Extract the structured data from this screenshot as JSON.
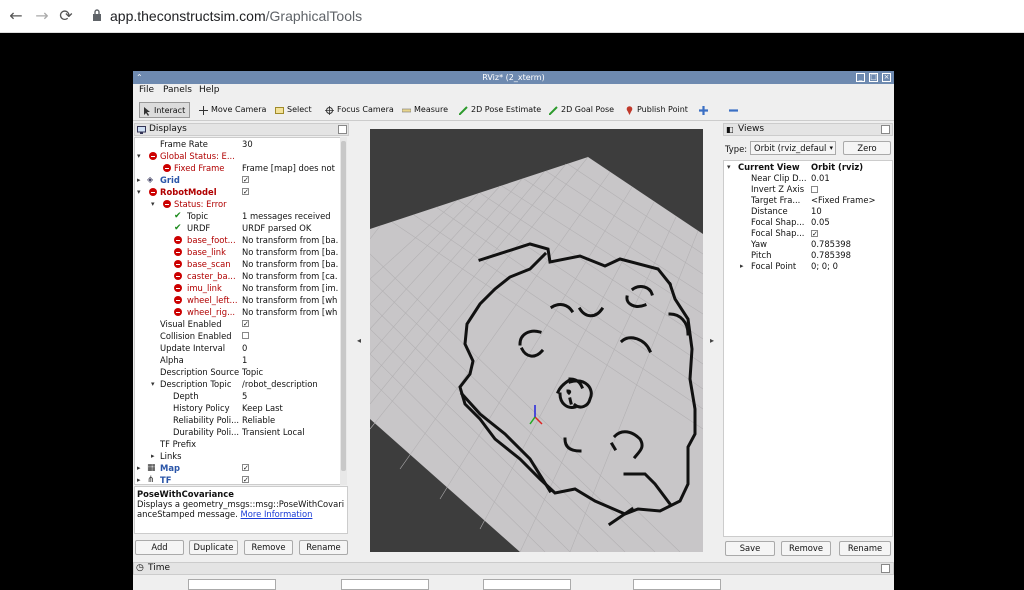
{
  "browser": {
    "url_host": "app.theconstructsim.com",
    "url_path": "/GraphicalTools"
  },
  "window": {
    "title": "RViz* (2_xterm)"
  },
  "menu": [
    "File",
    "Panels",
    "Help"
  ],
  "toolbar": {
    "interact": "Interact",
    "move_camera": "Move Camera",
    "select": "Select",
    "focus_camera": "Focus Camera",
    "measure": "Measure",
    "pose_estimate": "2D Pose Estimate",
    "goal_pose": "2D Goal Pose",
    "publish_point": "Publish Point"
  },
  "displays": {
    "title": "Displays",
    "rows": {
      "frame_rate_k": "Frame Rate",
      "frame_rate_v": "30",
      "global_status_k": "Global Status: E...",
      "fixed_frame_k": "Fixed Frame",
      "fixed_frame_v": "Frame [map] does not ...",
      "grid_k": "Grid",
      "robot_model_k": "RobotModel",
      "status_error_k": "Status: Error",
      "topic_k": "Topic",
      "topic_v": "1 messages received",
      "urdf_k": "URDF",
      "urdf_v": "URDF parsed OK",
      "base_foot_k": "base_foot...",
      "base_foot_v": "No transform from [ba...",
      "base_link_k": "base_link",
      "base_link_v": "No transform from [ba...",
      "base_scan_k": "base_scan",
      "base_scan_v": "No transform from [ba...",
      "caster_k": "caster_ba...",
      "caster_v": "No transform from [ca...",
      "imu_k": "imu_link",
      "imu_v": "No transform from [im...",
      "wheel_left_k": "wheel_left...",
      "wheel_left_v": "No transform from [wh...",
      "wheel_right_k": "wheel_rig...",
      "wheel_right_v": "No transform from [wh...",
      "visual_k": "Visual Enabled",
      "collision_k": "Collision Enabled",
      "update_k": "Update Interval",
      "update_v": "0",
      "alpha_k": "Alpha",
      "alpha_v": "1",
      "desc_source_k": "Description Source",
      "desc_source_v": "Topic",
      "desc_topic_k": "Description Topic",
      "desc_topic_v": "/robot_description",
      "depth_k": "Depth",
      "depth_v": "5",
      "history_k": "History Policy",
      "history_v": "Keep Last",
      "reliability_k": "Reliability Poli...",
      "reliability_v": "Reliable",
      "durability_k": "Durability Poli...",
      "durability_v": "Transient Local",
      "tf_prefix_k": "TF Prefix",
      "links_k": "Links",
      "map_k": "Map",
      "tf_k": "TF"
    },
    "checkmark": "✓",
    "description_title": "PoseWithCovariance",
    "description_text": "Displays a geometry_msgs::msg::PoseWithCovarianceStamped message.",
    "description_link": "More Information",
    "buttons": {
      "add": "Add",
      "duplicate": "Duplicate",
      "remove": "Remove",
      "rename": "Rename"
    }
  },
  "views": {
    "title": "Views",
    "type_label": "Type:",
    "type_value": "Orbit (rviz_defaul",
    "zero": "Zero",
    "current_view_k": "Current View",
    "current_view_v": "Orbit (rviz)",
    "near_clip_k": "Near Clip D...",
    "near_clip_v": "0.01",
    "invert_z_k": "Invert Z Axis",
    "target_frame_k": "Target Fra...",
    "target_frame_v": "<Fixed Frame>",
    "distance_k": "Distance",
    "distance_v": "10",
    "focal_shape1_k": "Focal Shap...",
    "focal_shape1_v": "0.05",
    "focal_shape2_k": "Focal Shap...",
    "yaw_k": "Yaw",
    "yaw_v": "0.785398",
    "pitch_k": "Pitch",
    "pitch_v": "0.785398",
    "focal_point_k": "Focal Point",
    "focal_point_v": "0; 0; 0",
    "buttons": {
      "save": "Save",
      "remove": "Remove",
      "rename": "Rename"
    }
  },
  "time": {
    "title": "Time"
  }
}
